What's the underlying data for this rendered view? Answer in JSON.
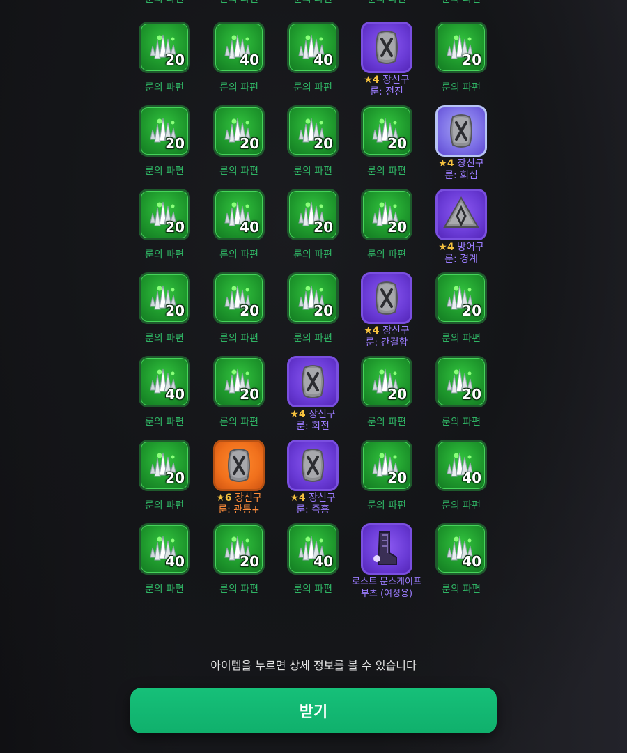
{
  "grid": {
    "top_row_labels": [
      "룬의 파편",
      "룬의 파편",
      "룬의 파편",
      "룬의 파편",
      "룬의 파편"
    ],
    "rows": [
      [
        {
          "kind": "shard",
          "count": "20",
          "label": "룬의 파편"
        },
        {
          "kind": "shard",
          "count": "40",
          "label": "룬의 파편"
        },
        {
          "kind": "shard",
          "count": "40",
          "label": "룬의 파편"
        },
        {
          "kind": "rune",
          "frame": "purple",
          "icon": "rune-x-stone-icon",
          "stars": "4",
          "type": "장신구",
          "name": "룬: 전진"
        },
        {
          "kind": "shard",
          "count": "20",
          "label": "룬의 파편"
        }
      ],
      [
        {
          "kind": "shard",
          "count": "20",
          "label": "룬의 파편"
        },
        {
          "kind": "shard",
          "count": "20",
          "label": "룬의 파편"
        },
        {
          "kind": "shard",
          "count": "20",
          "label": "룬의 파편"
        },
        {
          "kind": "shard",
          "count": "20",
          "label": "룬의 파편"
        },
        {
          "kind": "rune",
          "frame": "blue",
          "icon": "rune-x-stone-icon",
          "stars": "4",
          "type": "장신구",
          "name": "룬: 회심"
        }
      ],
      [
        {
          "kind": "shard",
          "count": "20",
          "label": "룬의 파편"
        },
        {
          "kind": "shard",
          "count": "40",
          "label": "룬의 파편"
        },
        {
          "kind": "shard",
          "count": "20",
          "label": "룬의 파편"
        },
        {
          "kind": "shard",
          "count": "20",
          "label": "룬의 파편"
        },
        {
          "kind": "rune",
          "frame": "purple",
          "icon": "rune-triangle-stone-icon",
          "stars": "4",
          "type": "방어구",
          "name": "룬: 경계"
        }
      ],
      [
        {
          "kind": "shard",
          "count": "20",
          "label": "룬의 파편"
        },
        {
          "kind": "shard",
          "count": "20",
          "label": "룬의 파편"
        },
        {
          "kind": "shard",
          "count": "20",
          "label": "룬의 파편"
        },
        {
          "kind": "rune",
          "frame": "purple",
          "icon": "rune-x-stone-icon",
          "stars": "4",
          "type": "장신구",
          "name": "룬: 간결함"
        },
        {
          "kind": "shard",
          "count": "20",
          "label": "룬의 파편"
        }
      ],
      [
        {
          "kind": "shard",
          "count": "40",
          "label": "룬의 파편"
        },
        {
          "kind": "shard",
          "count": "20",
          "label": "룬의 파편"
        },
        {
          "kind": "rune",
          "frame": "purple",
          "icon": "rune-x-stone-icon",
          "stars": "4",
          "type": "장신구",
          "name": "룬: 회전"
        },
        {
          "kind": "shard",
          "count": "20",
          "label": "룬의 파편"
        },
        {
          "kind": "shard",
          "count": "20",
          "label": "룬의 파편"
        }
      ],
      [
        {
          "kind": "shard",
          "count": "20",
          "label": "룬의 파편"
        },
        {
          "kind": "rune",
          "frame": "orange",
          "icon": "rune-x-stone-icon",
          "stars": "6",
          "type": "장신구",
          "name": "룬: 관통+"
        },
        {
          "kind": "rune",
          "frame": "purple",
          "icon": "rune-x-stone-icon",
          "stars": "4",
          "type": "장신구",
          "name": "룬: 즉흥"
        },
        {
          "kind": "shard",
          "count": "20",
          "label": "룬의 파편"
        },
        {
          "kind": "shard",
          "count": "40",
          "label": "룬의 파편"
        }
      ],
      [
        {
          "kind": "shard",
          "count": "40",
          "label": "룬의 파편"
        },
        {
          "kind": "shard",
          "count": "20",
          "label": "룬의 파편"
        },
        {
          "kind": "shard",
          "count": "40",
          "label": "룬의 파편"
        },
        {
          "kind": "item",
          "frame": "purple",
          "icon": "boots-icon",
          "line1": "로스트 문스케이프",
          "line2": "부츠 (여성용)"
        },
        {
          "kind": "shard",
          "count": "40",
          "label": "룬의 파편"
        }
      ]
    ]
  },
  "hint": "아이템을 누르면 상세 정보를 볼 수 있습니다",
  "claim_button": "받기",
  "colors": {
    "shard_label": "#2fb364",
    "rune_text": "#9b7cff",
    "legendary_text": "#ff8d3b",
    "star": "#f6c23e",
    "button": "#10b06c"
  }
}
